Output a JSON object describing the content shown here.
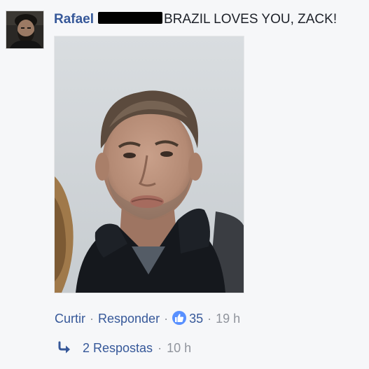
{
  "comment": {
    "author": "Rafael",
    "text": "BRAZIL LOVES YOU, ZACK!",
    "avatar_icon": "user-avatar",
    "photo_icon": "attached-photo"
  },
  "actions": {
    "like": "Curtir",
    "reply": "Responder",
    "separator": "·",
    "like_icon": "thumbs-up-icon",
    "like_count": "35",
    "time": "19 h"
  },
  "replies": {
    "icon": "reply-arrow-icon",
    "label": "2 Respostas",
    "time": "10 h"
  },
  "colors": {
    "link": "#365899",
    "meta": "#90949c",
    "background": "#f6f7f9",
    "like_badge": "#5890ff"
  }
}
